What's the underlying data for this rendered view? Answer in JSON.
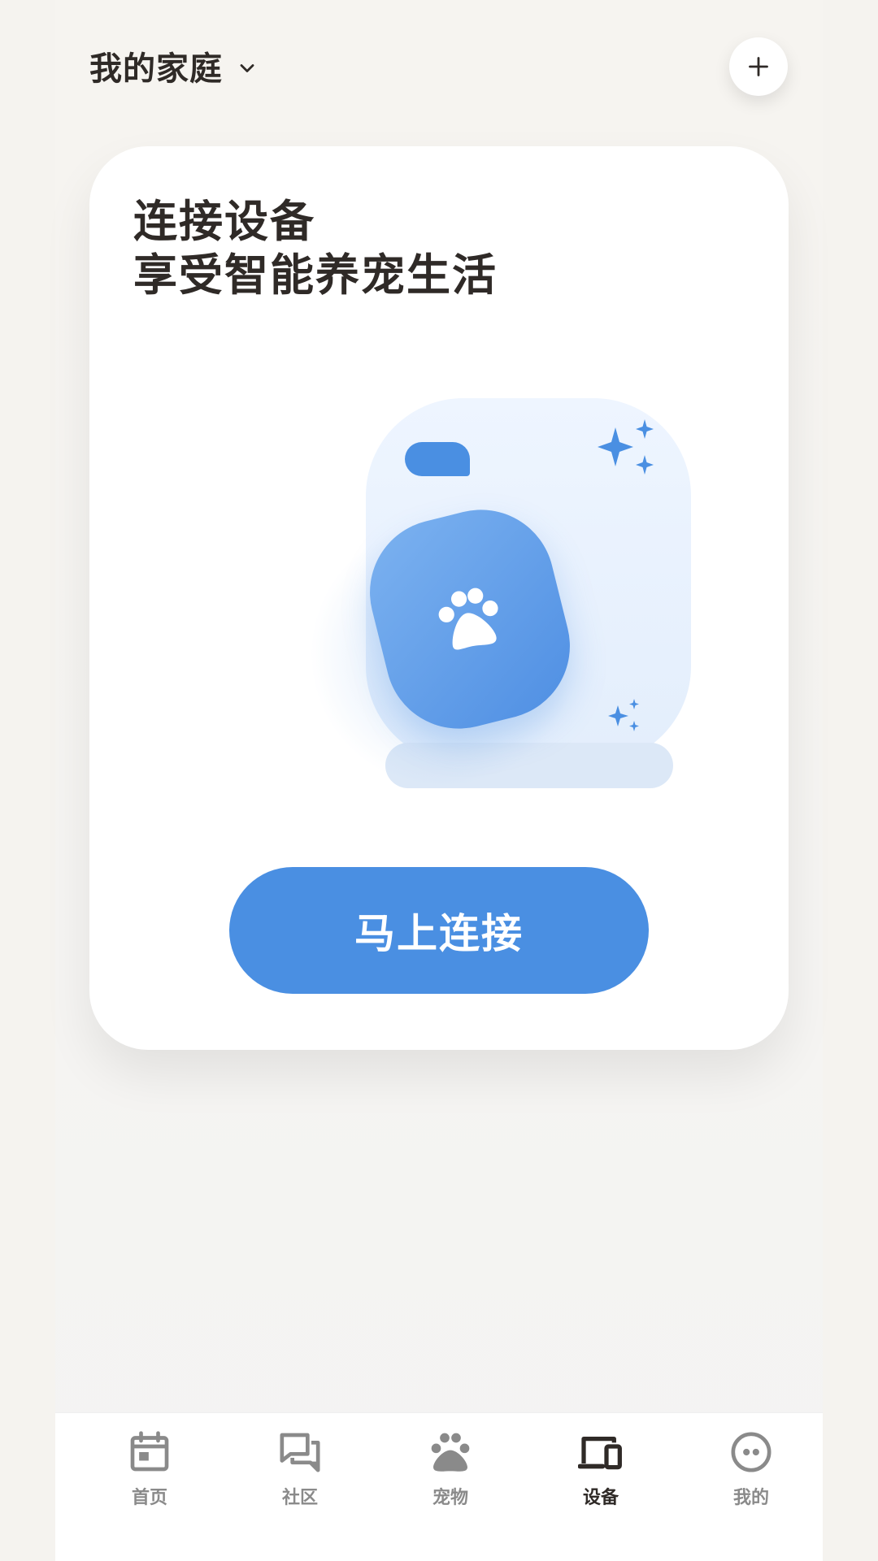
{
  "header": {
    "home_title": "我的家庭"
  },
  "card": {
    "title_line1": "连接设备",
    "title_line2": "享受智能养宠生活",
    "connect_button": "马上连接"
  },
  "tabs": [
    {
      "label": "首页",
      "icon": "calendar-icon",
      "active": false
    },
    {
      "label": "社区",
      "icon": "chat-icon",
      "active": false
    },
    {
      "label": "宠物",
      "icon": "paw-icon",
      "active": false
    },
    {
      "label": "设备",
      "icon": "devices-icon",
      "active": true
    },
    {
      "label": "我的",
      "icon": "profile-icon",
      "active": false
    }
  ],
  "colors": {
    "accent": "#4a8fe2",
    "text_dark": "#2f2a27",
    "text_muted": "#8a8a8a",
    "background": "#f5f3ef"
  }
}
